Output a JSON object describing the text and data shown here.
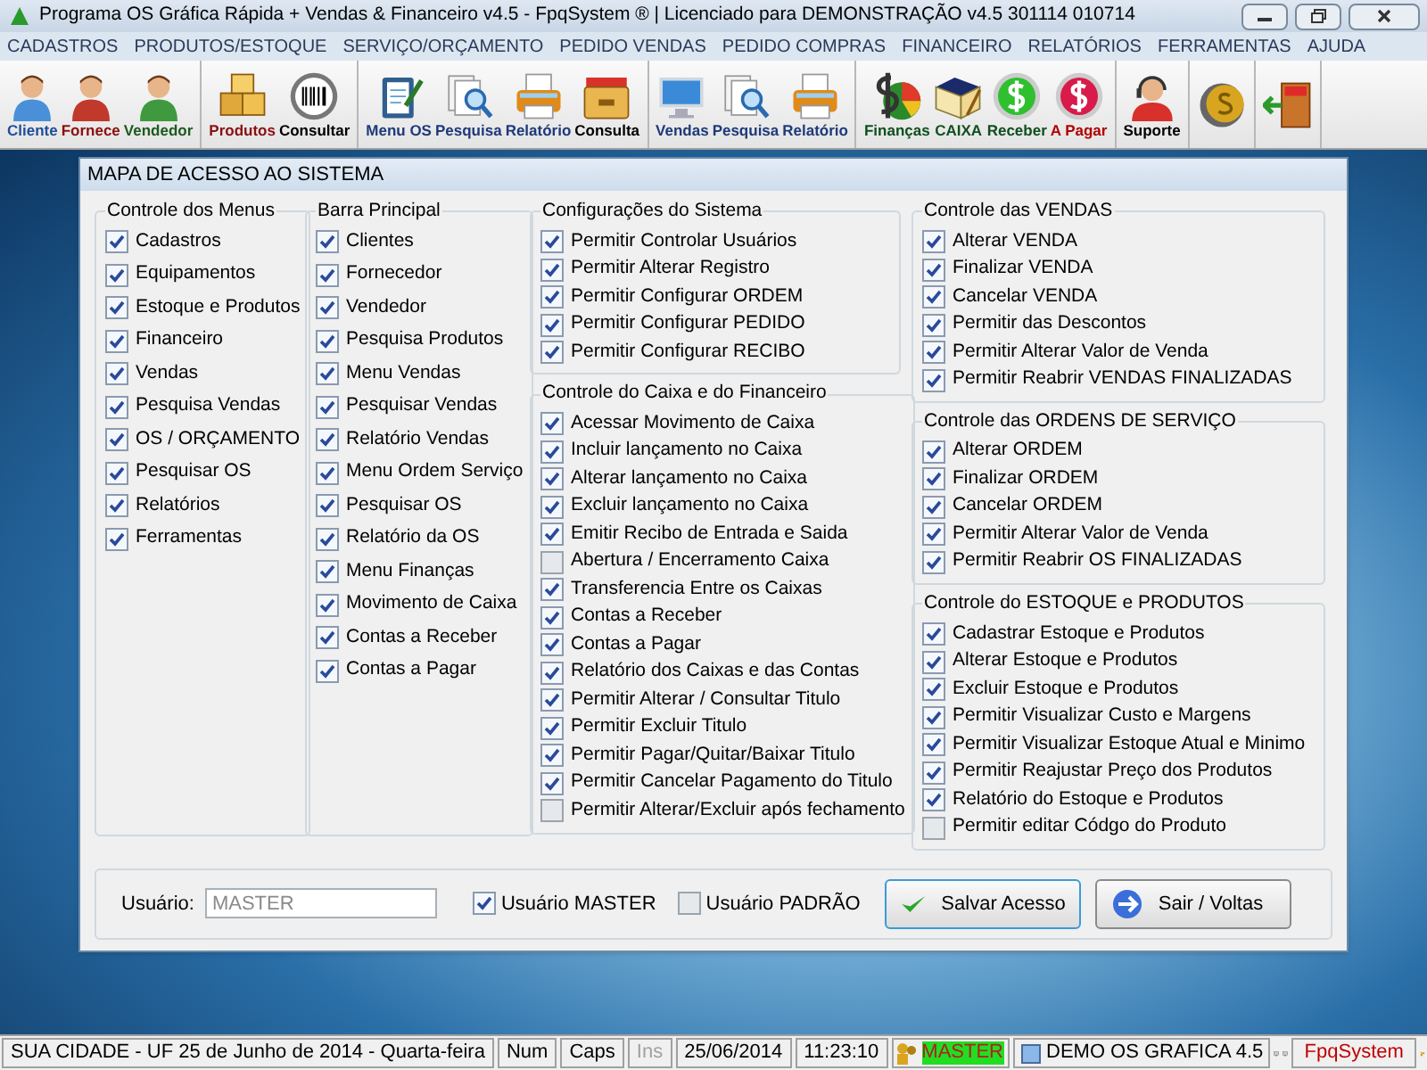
{
  "window": {
    "title": "Programa OS Gráfica Rápida + Vendas & Financeiro v4.5 - FpqSystem ® | Licenciado para  DEMONSTRAÇÃO v4.5 301114 010714"
  },
  "menu": [
    "CADASTROS",
    "PRODUTOS/ESTOQUE",
    "SERVIÇO/ORÇAMENTO",
    "PEDIDO VENDAS",
    "PEDIDO COMPRAS",
    "FINANCEIRO",
    "RELATÓRIOS",
    "FERRAMENTAS",
    "AJUDA"
  ],
  "toolbar": [
    {
      "items": [
        {
          "label": "Cliente",
          "kind": "person",
          "color": "#1f4e9a"
        },
        {
          "label": "Fornece",
          "kind": "person-red",
          "color": "#8b1010"
        },
        {
          "label": "Vendedor",
          "kind": "person-green",
          "color": "#1f5a1f"
        }
      ]
    },
    {
      "items": [
        {
          "label": "Produtos",
          "kind": "boxes",
          "color": "#8b1010"
        },
        {
          "label": "Consultar",
          "kind": "barcode",
          "color": "#000000"
        }
      ]
    },
    {
      "items": [
        {
          "label": "Menu OS",
          "kind": "clipboard",
          "color": "#1f3a7a"
        },
        {
          "label": "Pesquisa",
          "kind": "search",
          "color": "#1f3a7a"
        },
        {
          "label": "Relatório",
          "kind": "printer",
          "color": "#1f3a7a"
        },
        {
          "label": "Consulta",
          "kind": "drawer",
          "color": "#000000"
        }
      ]
    },
    {
      "items": [
        {
          "label": "Vendas",
          "kind": "monitor",
          "color": "#1f3a7a"
        },
        {
          "label": "Pesquisa",
          "kind": "search",
          "color": "#1f3a7a"
        },
        {
          "label": "Relatório",
          "kind": "printer",
          "color": "#1f3a7a"
        }
      ]
    },
    {
      "items": [
        {
          "label": "Finanças",
          "kind": "money",
          "color": "#0f4f1f"
        },
        {
          "label": "CAIXA",
          "kind": "book",
          "color": "#0f4f1f"
        },
        {
          "label": "Receber",
          "kind": "coin-green",
          "color": "#0f4f1f"
        },
        {
          "label": "A Pagar",
          "kind": "coin-red",
          "color": "#b00000"
        }
      ]
    },
    {
      "items": [
        {
          "label": "Suporte",
          "kind": "support",
          "color": "#000000"
        }
      ]
    },
    {
      "items": [
        {
          "kind": "coin-gold"
        }
      ]
    },
    {
      "items": [
        {
          "kind": "exit"
        }
      ]
    }
  ],
  "dialog": {
    "title": "MAPA DE ACESSO AO SISTEMA",
    "columns": [
      {
        "groups": [
          {
            "title": "Controle dos Menus",
            "items": [
              {
                "label": "Cadastros",
                "checked": true
              },
              {
                "label": "Equipamentos",
                "checked": true
              },
              {
                "label": "Estoque e Produtos",
                "checked": true
              },
              {
                "label": "Financeiro",
                "checked": true
              },
              {
                "label": "Vendas",
                "checked": true
              },
              {
                "label": "Pesquisa Vendas",
                "checked": true
              },
              {
                "label": "OS / ORÇAMENTO",
                "checked": true
              },
              {
                "label": "Pesquisar OS",
                "checked": true
              },
              {
                "label": "Relatórios",
                "checked": true
              },
              {
                "label": "Ferramentas",
                "checked": true
              }
            ]
          }
        ]
      },
      {
        "groups": [
          {
            "title": "Barra Principal",
            "items": [
              {
                "label": "Clientes",
                "checked": true
              },
              {
                "label": "Fornecedor",
                "checked": true
              },
              {
                "label": "Vendedor",
                "checked": true
              },
              {
                "label": "Pesquisa Produtos",
                "checked": true
              },
              {
                "label": "Menu Vendas",
                "checked": true
              },
              {
                "label": "Pesquisar Vendas",
                "checked": true
              },
              {
                "label": "Relatório Vendas",
                "checked": true
              },
              {
                "label": "Menu Ordem Serviço",
                "checked": true
              },
              {
                "label": "Pesquisar OS",
                "checked": true
              },
              {
                "label": "Relatório da OS",
                "checked": true
              },
              {
                "label": "Menu Finanças",
                "checked": true
              },
              {
                "label": "Movimento de Caixa",
                "checked": true
              },
              {
                "label": "Contas a Receber",
                "checked": true
              },
              {
                "label": "Contas a Pagar",
                "checked": true
              }
            ]
          }
        ]
      },
      {
        "groups": [
          {
            "title": "Configurações do Sistema",
            "items": [
              {
                "label": "Permitir Controlar Usuários",
                "checked": true
              },
              {
                "label": "Permitir Alterar Registro",
                "checked": true
              },
              {
                "label": "Permitir Configurar ORDEM",
                "checked": true
              },
              {
                "label": "Permitir Configurar PEDIDO",
                "checked": true
              },
              {
                "label": "Permitir Configurar RECIBO",
                "checked": true
              }
            ]
          },
          {
            "title": "Controle do Caixa e do Financeiro",
            "items": [
              {
                "label": "Acessar Movimento de Caixa",
                "checked": true
              },
              {
                "label": "Incluir lançamento no Caixa",
                "checked": true
              },
              {
                "label": "Alterar lançamento no Caixa",
                "checked": true
              },
              {
                "label": "Excluir lançamento no Caixa",
                "checked": true
              },
              {
                "label": "Emitir Recibo de Entrada e Saida",
                "checked": true
              },
              {
                "label": "Abertura / Encerramento Caixa",
                "checked": false
              },
              {
                "label": "Transferencia Entre os Caixas",
                "checked": true
              },
              {
                "label": "Contas a Receber",
                "checked": true
              },
              {
                "label": "Contas a Pagar",
                "checked": true
              },
              {
                "label": "Relatório dos Caixas e das Contas",
                "checked": true
              },
              {
                "label": "Permitir Alterar / Consultar Titulo",
                "checked": true
              },
              {
                "label": "Permitir Excluir Titulo",
                "checked": true
              },
              {
                "label": "Permitir Pagar/Quitar/Baixar Titulo",
                "checked": true
              },
              {
                "label": "Permitir Cancelar Pagamento do Titulo",
                "checked": true
              },
              {
                "label": "Permitir Alterar/Excluir após fechamento",
                "checked": false
              }
            ]
          }
        ]
      },
      {
        "groups": [
          {
            "title": "Controle das VENDAS",
            "items": [
              {
                "label": "Alterar VENDA",
                "checked": true
              },
              {
                "label": "Finalizar VENDA",
                "checked": true
              },
              {
                "label": "Cancelar VENDA",
                "checked": true
              },
              {
                "label": "Permitir das Descontos",
                "checked": true
              },
              {
                "label": "Permitir Alterar Valor de Venda",
                "checked": true
              },
              {
                "label": "Permitir Reabrir VENDAS FINALIZADAS",
                "checked": true
              }
            ]
          },
          {
            "title": "Controle das ORDENS DE SERVIÇO",
            "items": [
              {
                "label": "Alterar ORDEM",
                "checked": true
              },
              {
                "label": "Finalizar ORDEM",
                "checked": true
              },
              {
                "label": "Cancelar ORDEM",
                "checked": true
              },
              {
                "label": "Permitir Alterar Valor de Venda",
                "checked": true
              },
              {
                "label": "Permitir Reabrir OS FINALIZADAS",
                "checked": true
              }
            ]
          },
          {
            "title": "Controle do ESTOQUE e PRODUTOS",
            "items": [
              {
                "label": "Cadastrar Estoque e Produtos",
                "checked": true
              },
              {
                "label": "Alterar Estoque e Produtos",
                "checked": true
              },
              {
                "label": "Excluir Estoque e Produtos",
                "checked": true
              },
              {
                "label": "Permitir Visualizar Custo e Margens",
                "checked": true
              },
              {
                "label": "Permitir Visualizar Estoque Atual e Minimo",
                "checked": true
              },
              {
                "label": "Permitir Reajustar Preço dos Produtos",
                "checked": true
              },
              {
                "label": "Relatório do Estoque e Produtos",
                "checked": true
              },
              {
                "label": "Permitir editar Códgo do Produto",
                "checked": false
              }
            ]
          }
        ]
      }
    ],
    "footer": {
      "user_label": "Usuário:",
      "user_value": "MASTER",
      "user_disabled": true,
      "options": [
        {
          "label": "Usuário MASTER",
          "checked": true
        },
        {
          "label": "Usuário PADRÃO",
          "checked": false
        }
      ],
      "buttons": [
        {
          "label": "Salvar Acesso",
          "kind": "check"
        },
        {
          "label": "Sair / Voltas",
          "kind": "arrow"
        }
      ]
    }
  },
  "status_bar": [
    {
      "kind": "panel",
      "text": "SUA CIDADE - UF 25 de Junho de 2014 - Quarta-feira",
      "disabled": false
    },
    {
      "kind": "panel",
      "text": "Num",
      "disabled": false
    },
    {
      "kind": "panel",
      "text": "Caps",
      "disabled": false
    },
    {
      "kind": "panel",
      "text": "Ins",
      "disabled": true
    },
    {
      "kind": "panel",
      "text": "25/06/2014",
      "disabled": false
    },
    {
      "kind": "panel",
      "text": "11:23:10",
      "disabled": false
    },
    {
      "kind": "user",
      "text": "MASTER"
    },
    {
      "kind": "app",
      "text": "DEMO OS GRAFICA 4.5"
    },
    {
      "kind": "icon"
    },
    {
      "kind": "icon"
    },
    {
      "kind": "brand",
      "text": "FpqSystem"
    },
    {
      "kind": "keys"
    }
  ]
}
